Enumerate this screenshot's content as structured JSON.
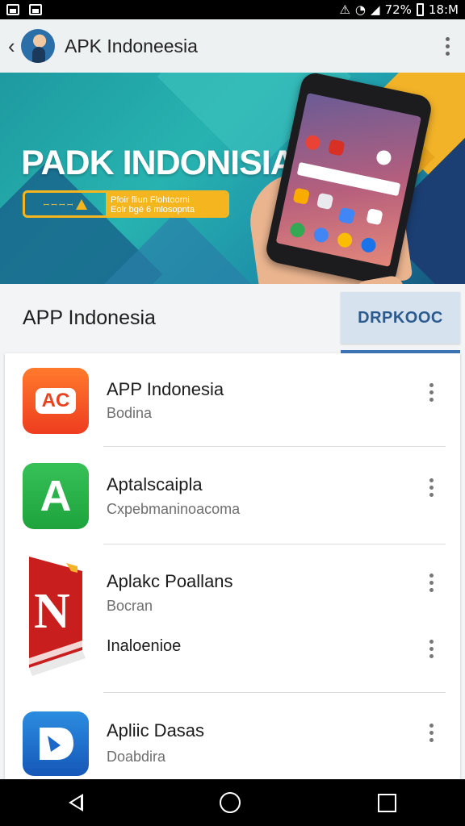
{
  "status_bar": {
    "battery": "72%",
    "time": "18:M",
    "icons": [
      "image-icon",
      "photo-icon",
      "mute-icon",
      "wifi-icon",
      "signal-icon",
      "battery-icon"
    ]
  },
  "app_bar": {
    "title": "APK Indoneesia",
    "icons": [
      "back-arrow-icon",
      "avatar",
      "more-vert-icon"
    ]
  },
  "banner": {
    "title": "PADK INDONISIA",
    "badge_left": "ꟷ ꟷ ꟷ ꟷ",
    "badge_right_line1": "Pfoir fliun Flohtoorni",
    "badge_right_line2": "Eolr bgé 6 mlosopnta"
  },
  "section": {
    "title": "APP Indonesia",
    "button": "DRPKOOC"
  },
  "apps": [
    {
      "icon": "ac-app-icon",
      "icon_text": "AC",
      "title": "APP Indonesia",
      "subtitle": "Bodina"
    },
    {
      "icon": "a-app-icon",
      "icon_text": "A",
      "title": "Aptalscaipla",
      "subtitle": "Cxpebmaninoacoma"
    },
    {
      "icon": "n-app-icon",
      "icon_text": "N",
      "title": "Aplakc Poallans",
      "subtitle": "Bocran",
      "extra": "Inaloenioe"
    },
    {
      "icon": "b-app-icon",
      "icon_text": "",
      "title": "Apliic Dasas",
      "subtitle": "Doabdira"
    }
  ],
  "colors": {
    "accent": "#3d74b4",
    "banner_teal": "#27b3b0",
    "banner_yellow": "#f4b51f"
  },
  "nav_bar": [
    "nav-back-icon",
    "nav-home-icon",
    "nav-recents-icon"
  ]
}
